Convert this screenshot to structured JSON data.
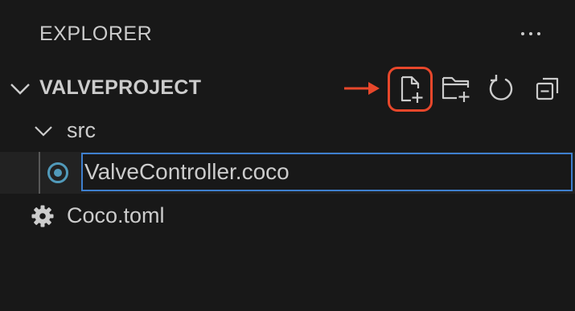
{
  "panel": {
    "title": "EXPLORER",
    "more_actions_icon": "ellipsis-icon"
  },
  "section": {
    "title": "VALVEPROJECT",
    "expanded": true,
    "toolbar": [
      {
        "icon": "new-file-icon",
        "highlighted": true
      },
      {
        "icon": "new-folder-icon",
        "highlighted": false
      },
      {
        "icon": "refresh-icon",
        "highlighted": false
      },
      {
        "icon": "collapse-all-icon",
        "highlighted": false
      }
    ],
    "annotation_color": "#e8472b"
  },
  "tree": {
    "folder": {
      "label": "src",
      "expanded": true
    },
    "rename_input": {
      "value": "ValveController.coco",
      "icon": "coco-file-icon",
      "icon_color": "#519aba"
    },
    "file": {
      "label": "Coco.toml",
      "icon": "gear-icon"
    }
  },
  "colors": {
    "background": "#181818",
    "focus_border": "#3e7fce",
    "text": "#cccccc"
  }
}
